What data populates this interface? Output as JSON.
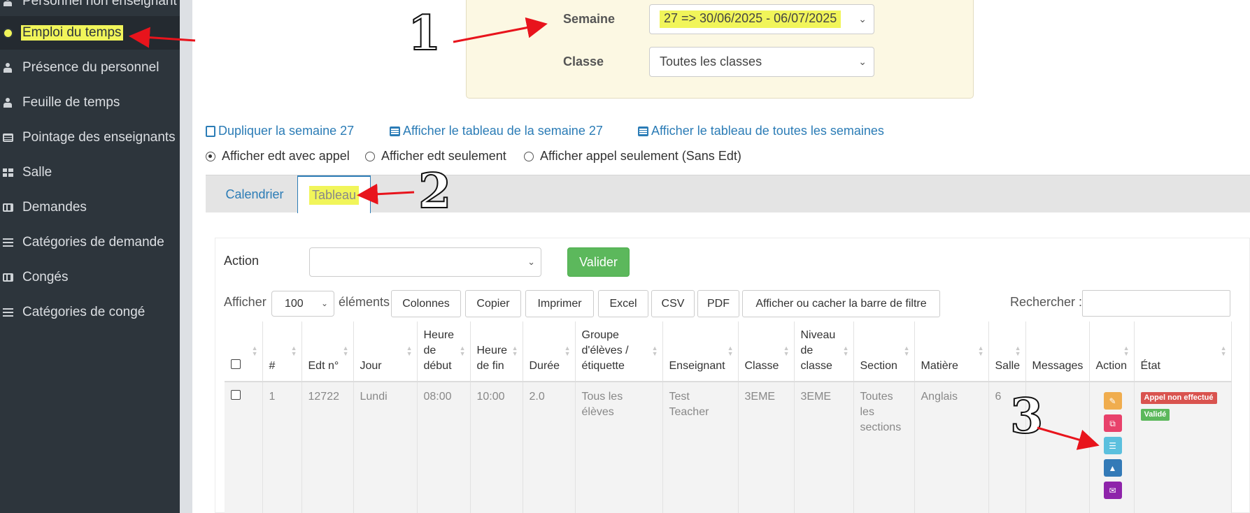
{
  "sidebar": {
    "items": [
      {
        "label": "Personnel non enseignant",
        "icon": "person-icon"
      },
      {
        "label": "Emploi du temps",
        "icon": "clock-icon"
      },
      {
        "label": "Présence du personnel",
        "icon": "person-icon"
      },
      {
        "label": "Feuille de temps",
        "icon": "people-icon"
      },
      {
        "label": "Pointage des enseignants",
        "icon": "list-icon"
      },
      {
        "label": "Salle",
        "icon": "grid-icon"
      },
      {
        "label": "Demandes",
        "icon": "briefcase-icon"
      },
      {
        "label": "Catégories de demande",
        "icon": "bars-icon"
      },
      {
        "label": "Congés",
        "icon": "briefcase-icon"
      },
      {
        "label": "Catégories de congé",
        "icon": "bars-icon"
      }
    ]
  },
  "filters": {
    "week_label": "Semaine",
    "week_value": "27  => 30/06/2025 - 06/07/2025",
    "class_label": "Classe",
    "class_value": "Toutes les classes"
  },
  "links": {
    "duplicate": "Dupliquer la semaine 27",
    "show_week_table": "Afficher le tableau de la semaine 27",
    "show_all_weeks": "Afficher le tableau de toutes les semaines"
  },
  "display_options": {
    "selected": "Afficher edt avec appel",
    "options": [
      "Afficher edt avec appel",
      "Afficher edt seulement",
      "Afficher appel seulement (Sans Edt)"
    ]
  },
  "tabs": {
    "calendar": "Calendrier",
    "table": "Tableau",
    "active": "Tableau"
  },
  "toolbar": {
    "action_label": "Action",
    "action_value": "",
    "validate": "Valider",
    "show_label": "Afficher",
    "page_size": "100",
    "elements_label": "éléments",
    "buttons": [
      "Colonnes",
      "Copier",
      "Imprimer",
      "Excel",
      "CSV",
      "PDF",
      "Afficher ou cacher la barre de filtre"
    ],
    "search_label": "Rechercher :",
    "search_value": ""
  },
  "table": {
    "headers": [
      "#",
      "Edt n°",
      "Jour",
      "Heure de début",
      "Heure de fin",
      "Durée",
      "Groupe d'élèves / étiquette",
      "Enseignant",
      "Classe",
      "Niveau de classe",
      "Section",
      "Matière",
      "Salle",
      "Messages",
      "Action",
      "État"
    ],
    "rows": [
      {
        "num": "1",
        "edt": "12722",
        "day": "Lundi",
        "start": "08:00",
        "end": "10:00",
        "duration": "2.0",
        "group": "Tous les élèves",
        "teacher": "Test Teacher",
        "class": "3EME",
        "level": "3EME",
        "section": "Toutes les sections",
        "subject": "Anglais",
        "room": "6",
        "messages": "",
        "actions": [
          {
            "icon": "edit-icon",
            "color": "#f0ad4e"
          },
          {
            "icon": "copy-icon",
            "color": "#e8416b"
          },
          {
            "icon": "list-icon",
            "color": "#5bc0de"
          },
          {
            "icon": "user-upload-icon",
            "color": "#337ab7"
          },
          {
            "icon": "bullhorn-icon",
            "color": "#8e24aa"
          }
        ],
        "badges": [
          {
            "text": "Appel non effectué",
            "color": "#d9534f"
          },
          {
            "text": "Validé",
            "color": "#5cb85c"
          }
        ]
      }
    ]
  },
  "annotations": {
    "one": "1",
    "two": "2",
    "three": "3",
    "highlight_color": "#f1f55a",
    "arrow_color": "#e8141c"
  }
}
